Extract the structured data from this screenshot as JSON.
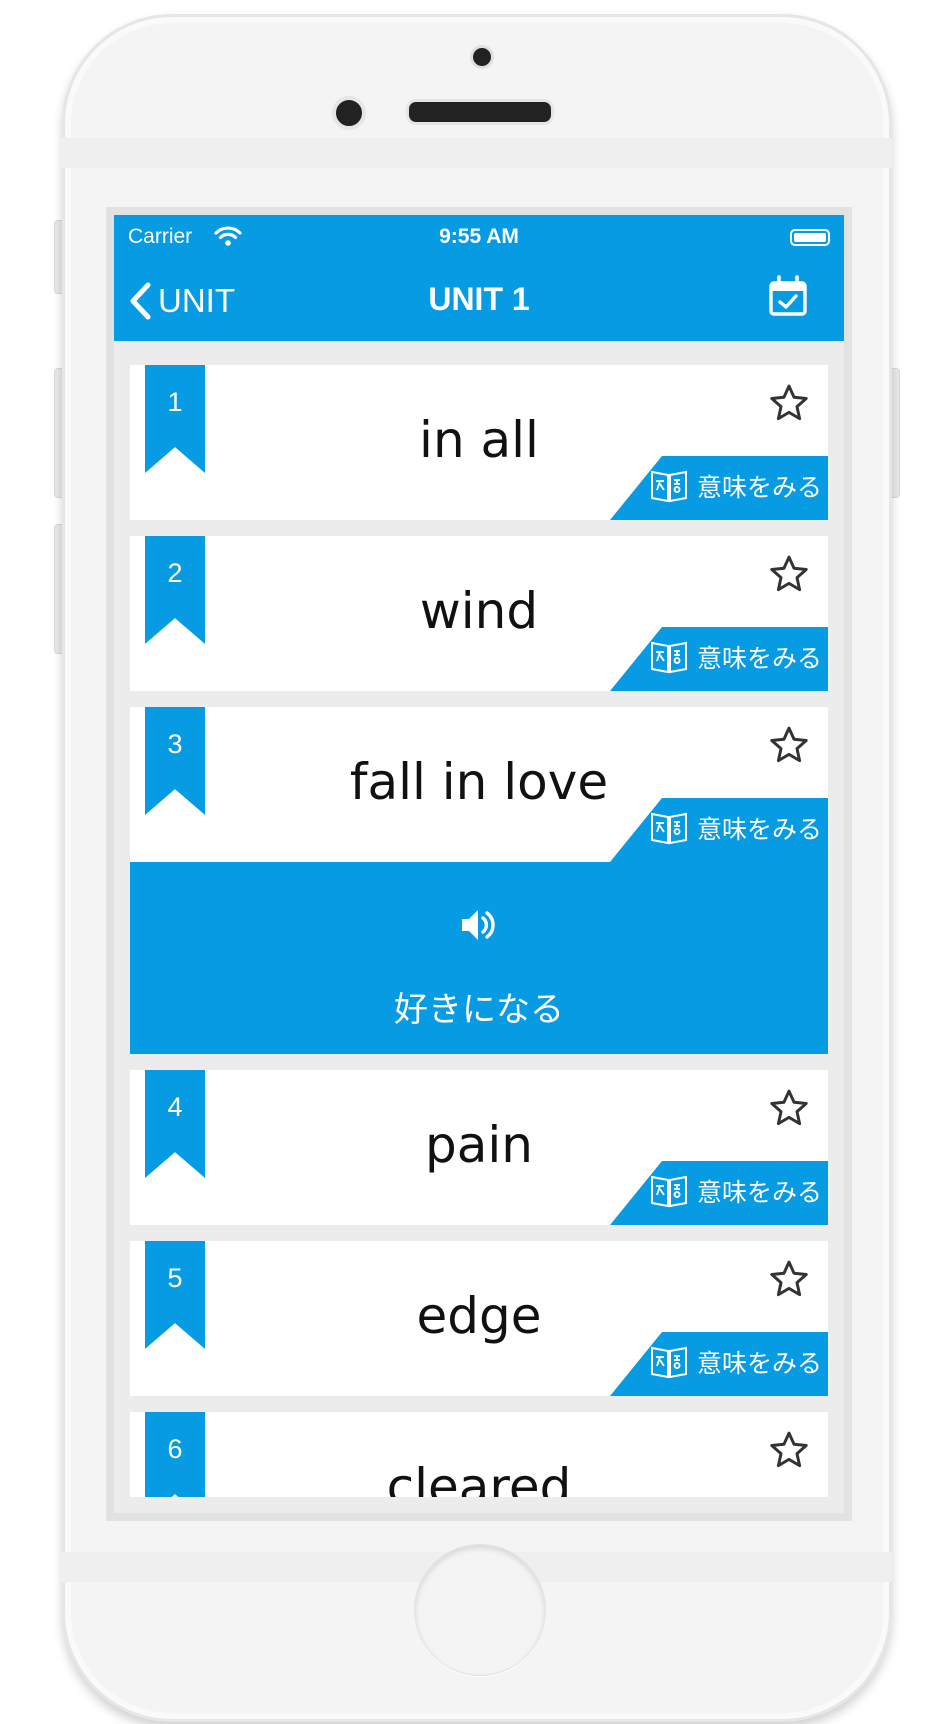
{
  "status_bar": {
    "carrier": "Carrier",
    "time": "9:55 AM"
  },
  "nav": {
    "back_label": "UNIT",
    "title": "UNIT 1"
  },
  "meaning_label": "意味をみる",
  "items": [
    {
      "number": "1",
      "word": "in all"
    },
    {
      "number": "2",
      "word": "wind"
    },
    {
      "number": "3",
      "word": "fall in love",
      "expanded": true,
      "translation": "好きになる"
    },
    {
      "number": "4",
      "word": "pain"
    },
    {
      "number": "5",
      "word": "edge"
    },
    {
      "number": "6",
      "word": "cleared"
    }
  ],
  "colors": {
    "accent": "#069be3",
    "background": "#ececec"
  },
  "icons": [
    "back-chevron-icon",
    "calendar-check-icon",
    "star-outline-icon",
    "book-icon",
    "speaker-icon",
    "wifi-icon",
    "battery-icon"
  ]
}
